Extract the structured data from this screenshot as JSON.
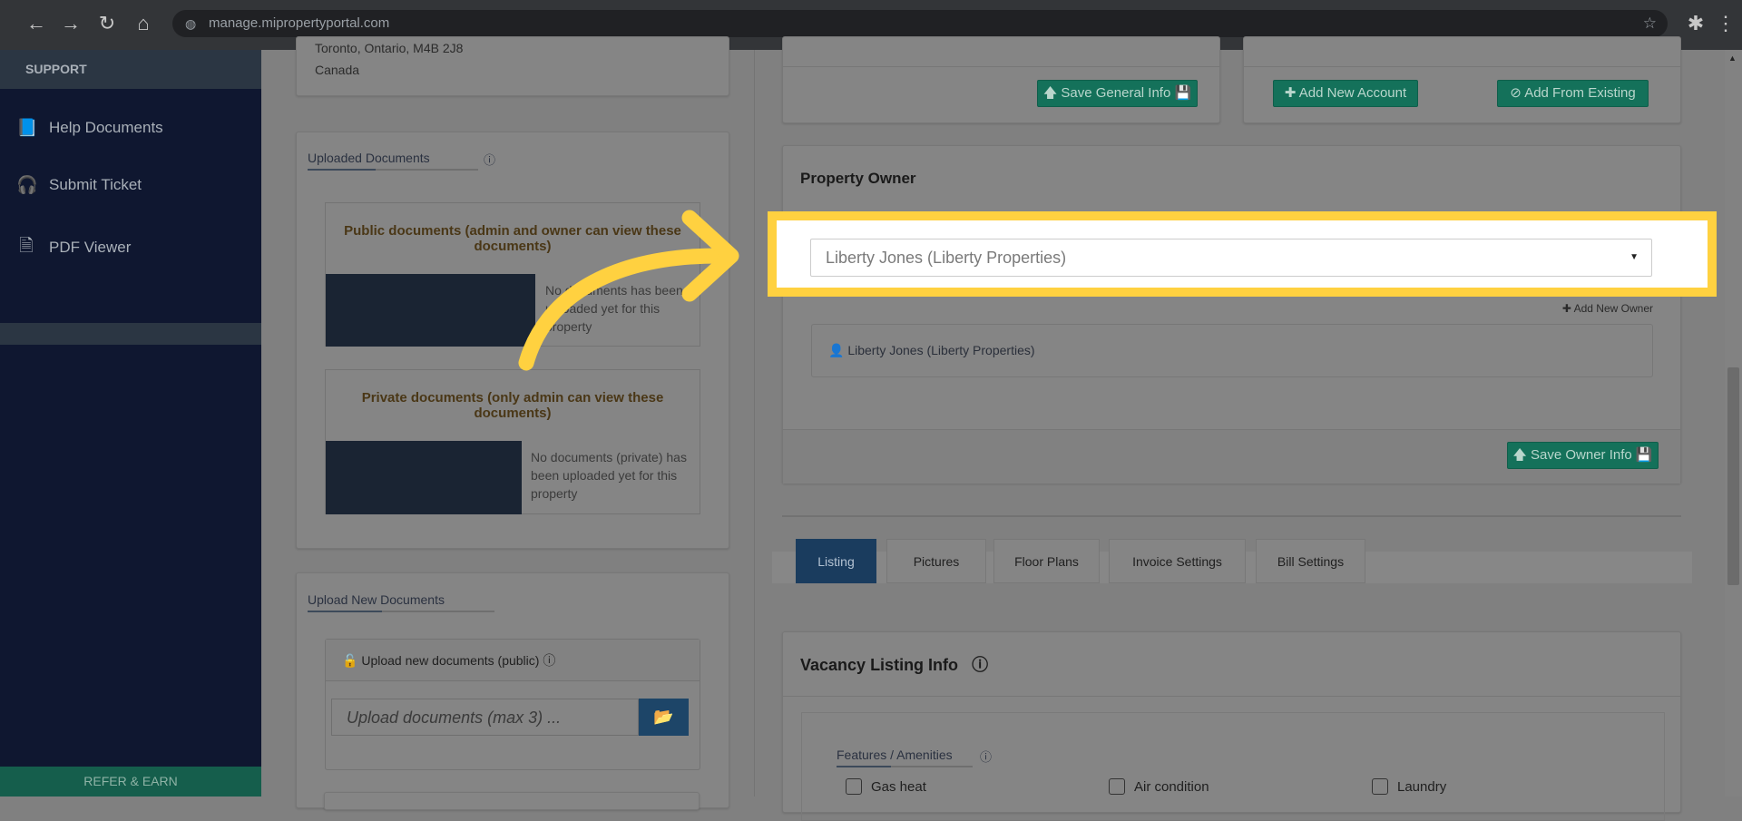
{
  "browser": {
    "url": "manage.mipropertyportal.com",
    "icons": [
      "back-icon",
      "forward-icon",
      "reload-icon",
      "home-icon",
      "star-icon",
      "extensions-icon",
      "menu-icon"
    ]
  },
  "sidebar": {
    "section": "SUPPORT",
    "items": [
      {
        "label": "Help Documents",
        "icon": "book-icon"
      },
      {
        "label": "Submit Ticket",
        "icon": "headset-icon"
      },
      {
        "label": "PDF Viewer",
        "icon": "pdf-icon"
      }
    ],
    "refer": "REFER & EARN"
  },
  "address": {
    "line": "Toronto, Ontario, M4B 2J8",
    "country": "Canada"
  },
  "uploaded": {
    "title": "Uploaded Documents",
    "public_title": "Public documents (admin and owner can view these documents)",
    "public_empty": "No documents has been uploaded yet for this property",
    "private_title": "Private documents (only admin can view these documents)",
    "private_empty": "No documents (private) has been uploaded yet for this property"
  },
  "upload_new": {
    "title": "Upload New Documents",
    "public_label": "Upload new documents (public)",
    "placeholder": "Upload documents (max 3) ..."
  },
  "buttons": {
    "save_general": "Save General Info",
    "add_account": "Add New Account",
    "add_existing": "Add From Existing",
    "save_owner": "Save Owner Info"
  },
  "owner": {
    "title": "Property Owner",
    "selected": "Liberty Jones (Liberty Properties)",
    "add_new": "Add New Owner",
    "list": [
      "Liberty Jones (Liberty Properties)"
    ]
  },
  "tabs": [
    "Listing",
    "Pictures",
    "Floor Plans",
    "Invoice Settings",
    "Bill Settings"
  ],
  "vacancy": {
    "title": "Vacancy Listing Info",
    "features_title": "Features / Amenities",
    "features": [
      "Gas heat",
      "Air condition",
      "Laundry"
    ]
  },
  "colors": {
    "highlight": "#ffd140",
    "green": "#14715a",
    "active_tab": "#1a3c5e"
  }
}
